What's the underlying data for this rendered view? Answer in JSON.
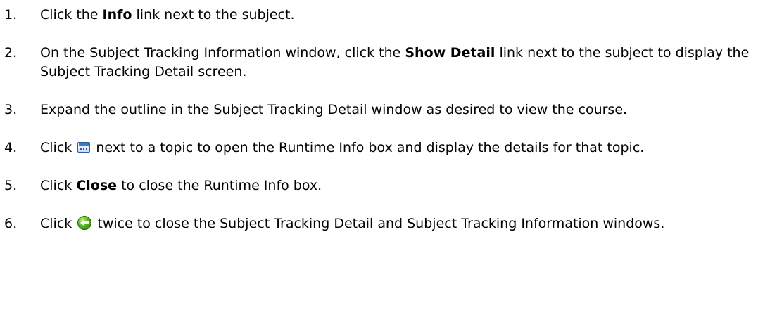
{
  "steps": [
    {
      "number": "1.",
      "parts": {
        "a": "Click the ",
        "b": "Info",
        "c": " link next to the subject."
      }
    },
    {
      "number": "2.",
      "parts": {
        "a": "On the Subject Tracking Information window, click the ",
        "b": "Show Detail",
        "c": " link next to the subject to display the Subject Tracking Detail screen."
      }
    },
    {
      "number": "3.",
      "text": "Expand the outline in the Subject Tracking Detail window as desired to view the course."
    },
    {
      "number": "4.",
      "parts": {
        "a": "Click ",
        "icon": "runtime-info-icon",
        "b": " next to a topic to open the Runtime Info box and display the details for that topic."
      }
    },
    {
      "number": "5.",
      "parts": {
        "a": "Click ",
        "b": "Close",
        "c": " to close the Runtime Info box."
      }
    },
    {
      "number": "6.",
      "parts": {
        "a": "Click ",
        "icon": "back-arrow-icon",
        "b": " twice to close the Subject Tracking Detail and Subject Tracking Information windows."
      }
    }
  ]
}
